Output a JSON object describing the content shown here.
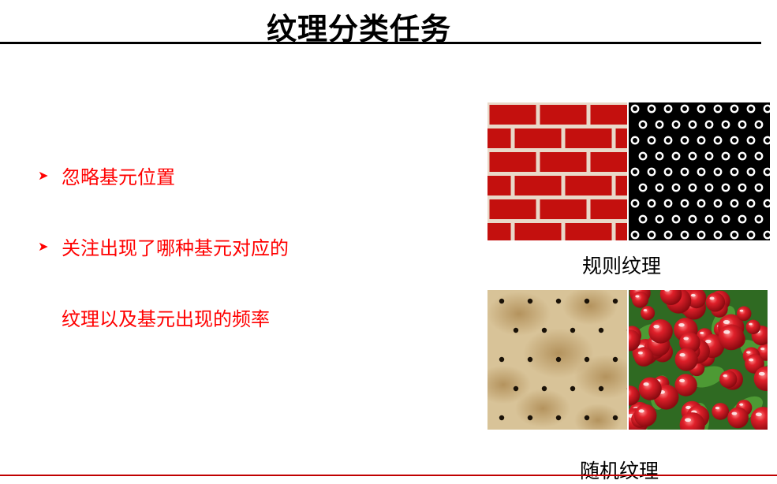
{
  "slide": {
    "title": "纹理分类任务",
    "bullets": [
      "忽略基元位置",
      "关注出现了哪种基元对应的"
    ],
    "bullet_continuation": "纹理以及基元出现的频率",
    "captions": {
      "regular": "规则纹理",
      "random": "随机纹理"
    },
    "images": {
      "brick": "brick-wall-texture",
      "dots": "white-rings-on-black-texture",
      "cracker": "cracker-surface-texture",
      "radish": "radishes-texture"
    },
    "colors": {
      "bullet_text": "#ff0000",
      "brick": "#c4100e",
      "mortar": "#e9d9c9",
      "cracker": "#d8c398",
      "radish": "#d8141c",
      "leaf": "#3f8a2a"
    }
  }
}
